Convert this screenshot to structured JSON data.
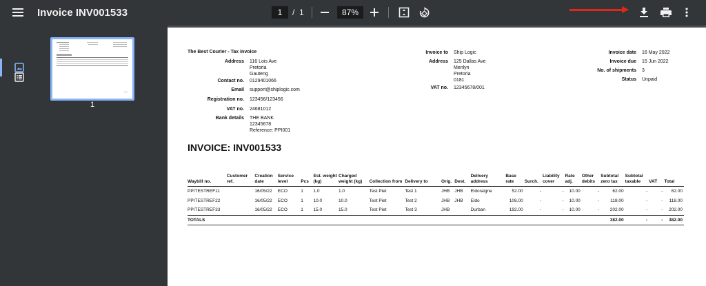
{
  "toolbar": {
    "title": "Invoice INV001533",
    "page_current": "1",
    "page_sep": "/",
    "page_total": "1",
    "zoom": "87%",
    "icons": [
      "menu-icon",
      "zoom-out-icon",
      "zoom-in-icon",
      "fit-page-icon",
      "rotate-icon",
      "download-icon",
      "print-icon",
      "more-vert-icon"
    ]
  },
  "sidebar": {
    "thumbnail_label": "1",
    "icons": [
      "thumbnail-view-icon",
      "outline-view-icon"
    ]
  },
  "colors": {
    "toolbar": "#323639",
    "background": "#525659",
    "accent": "#8ab4f8",
    "annotation_arrow": "#e1261c"
  },
  "document": {
    "company_heading": "The Best Courier - Tax invoice",
    "from": {
      "address_label": "Address",
      "address_lines": [
        "116 Lois Ave",
        "Pretoria",
        "Gauteng"
      ],
      "contact_label": "Contact no.",
      "contact": "0129401066",
      "email_label": "Email",
      "email": "support@shiplogic.com",
      "registration_label": "Registration no.",
      "registration": "123456/123456",
      "vat_label": "VAT no.",
      "vat": "24681012",
      "bank_label": "Bank details",
      "bank_lines": [
        "THE BANK",
        "12345678",
        "Reference: PPI001"
      ]
    },
    "to": {
      "invoice_to_label": "Invoice to",
      "invoice_to": "Ship Logic",
      "address_label": "Address",
      "address_lines": [
        "125 Dallas Ave",
        "Menlyn",
        "Pretoria",
        "0181"
      ],
      "vat_label": "VAT no.",
      "vat": "12345678/001"
    },
    "meta": {
      "date_label": "Invoice date",
      "date": "16 May 2022",
      "due_label": "Invoice due",
      "due": "15 Jun 2022",
      "shipments_label": "No. of shipments",
      "shipments": "3",
      "status_label": "Status",
      "status": "Unpaid"
    },
    "invoice_title": "INVOICE: INV001533",
    "columns": [
      "Waybill no.",
      "Customer ref.",
      "Creation date",
      "Service level",
      "Pcs",
      "Est. weight (kg)",
      "Charged weight (kg)",
      "Collection from",
      "Delivery to",
      "Orig.",
      "Dest.",
      "Delivery address",
      "Base rate",
      "Surch.",
      "Liability cover",
      "Rate adj.",
      "Other debits",
      "Subtotal zero tax",
      "Subtotal taxable",
      "VAT",
      "Total"
    ],
    "rows": [
      [
        "PPITESTREF11",
        "",
        "16/05/22",
        "ECO",
        "1",
        "1.0",
        "1.0",
        "Test Piet",
        "Test 1",
        "JHB",
        "JHB",
        "Eldoraigne",
        "52.00",
        "-",
        "-",
        "10.00",
        "-",
        "62.00",
        "-",
        "-",
        "62.00"
      ],
      [
        "PPITESTREF22",
        "",
        "16/05/22",
        "ECO",
        "1",
        "10.0",
        "10.0",
        "Test Piet",
        "Test 2",
        "JHB",
        "JHB",
        "Eldo",
        "108.00",
        "-",
        "-",
        "10.00",
        "-",
        "118.00",
        "-",
        "-",
        "118.00"
      ],
      [
        "PPITESTREF33",
        "",
        "16/05/22",
        "ECO",
        "1",
        "15.0",
        "15.0",
        "Test Piet",
        "Test 3",
        "JHB",
        "",
        "Durban",
        "192.00",
        "-",
        "-",
        "10.00",
        "-",
        "202.00",
        "-",
        "-",
        "202.00"
      ]
    ],
    "totals": {
      "label": "TOTALS",
      "subtotal_zero_tax": "382.00",
      "subtotal_taxable": "-",
      "vat": "-",
      "total": "382.00"
    }
  }
}
